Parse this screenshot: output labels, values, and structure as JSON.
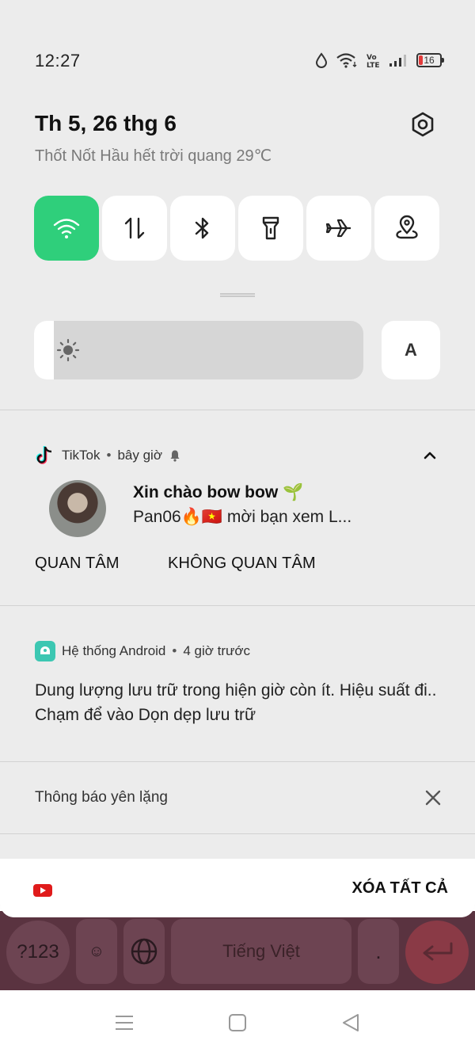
{
  "status_bar": {
    "time": "12:27",
    "battery": "16"
  },
  "header": {
    "date": "Th 5, 26 thg 6",
    "weather": "Thốt Nốt Hầu hết trời quang 29℃"
  },
  "quick_settings": {
    "tiles": [
      "wifi-icon",
      "mobile-data-icon",
      "bluetooth-icon",
      "flashlight-icon",
      "airplane-mode-icon",
      "location-icon"
    ],
    "active_tile": "wifi-icon",
    "active_color": "#2fcf7b",
    "brightness_level": 0.06,
    "auto_label": "A"
  },
  "tiktok_notification": {
    "app": "TikTok",
    "time": "bây giờ",
    "title": "Xin chào bow bow 🌱",
    "body": "Pan06🔥🇻🇳 mời bạn xem L...",
    "actions": [
      "QUAN TÂM",
      "KHÔNG QUAN TÂM"
    ]
  },
  "android_notification": {
    "app": "Hệ thống Android",
    "time": "4 giờ trước",
    "line1": "Dung lượng lưu trữ trong hiện giờ còn ít. Hiệu suất đi..",
    "line2": "Chạm để vào Dọn dẹp lưu trữ"
  },
  "silent_section": {
    "label": "Thông báo yên lặng"
  },
  "bottom": {
    "clear_all": "XÓA TẤT CẢ"
  },
  "keyboard": {
    "numeric_key": "?123",
    "space_label": "Tiếng Việt",
    "period": "."
  }
}
